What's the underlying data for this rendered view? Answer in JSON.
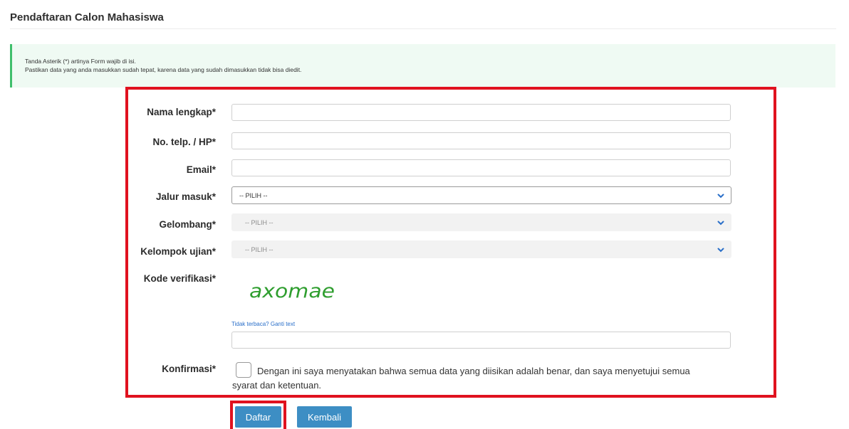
{
  "page": {
    "title": "Pendaftaran Calon Mahasiswa"
  },
  "notice": {
    "line1": "Tanda Asterik (*) artinya Form wajib di isi.",
    "line2": "Pastikan data yang anda masukkan sudah tepat, karena data yang sudah dimasukkan tidak bisa diedit."
  },
  "form": {
    "nama": {
      "label": "Nama lengkap*",
      "value": ""
    },
    "telp": {
      "label": "No. telp. / HP*",
      "value": ""
    },
    "email": {
      "label": "Email*",
      "value": ""
    },
    "jalur": {
      "label": "Jalur masuk*",
      "selected": "-- PILIH --",
      "enabled": true
    },
    "gelombang": {
      "label": "Gelombang*",
      "selected": "-- PILIH --",
      "enabled": false
    },
    "kelompok": {
      "label": "Kelompok ujian*",
      "selected": "-- PILIH --",
      "enabled": false
    },
    "verifikasi": {
      "label": "Kode verifikasi*",
      "captcha_image_text": "axomae",
      "refresh_link": "Tidak terbaca? Ganti text",
      "value": ""
    },
    "konfirmasi": {
      "label": "Konfirmasi*",
      "checked": false,
      "text_line1": "Dengan ini saya menyatakan bahwa semua data yang diisikan adalah benar, dan saya menyetujui semua",
      "text_line2": "syarat dan ketentuan."
    }
  },
  "buttons": {
    "submit": "Daftar",
    "back": "Kembali"
  },
  "colors": {
    "highlight_red": "#e0121f",
    "button_blue": "#3d8ec4",
    "notice_bg": "#effaf3",
    "notice_border": "#3fbf6c",
    "captcha_green": "#2f9e2f",
    "link_blue": "#2a6fc9"
  },
  "icons": {
    "select_arrow": "chevron-down-icon"
  }
}
